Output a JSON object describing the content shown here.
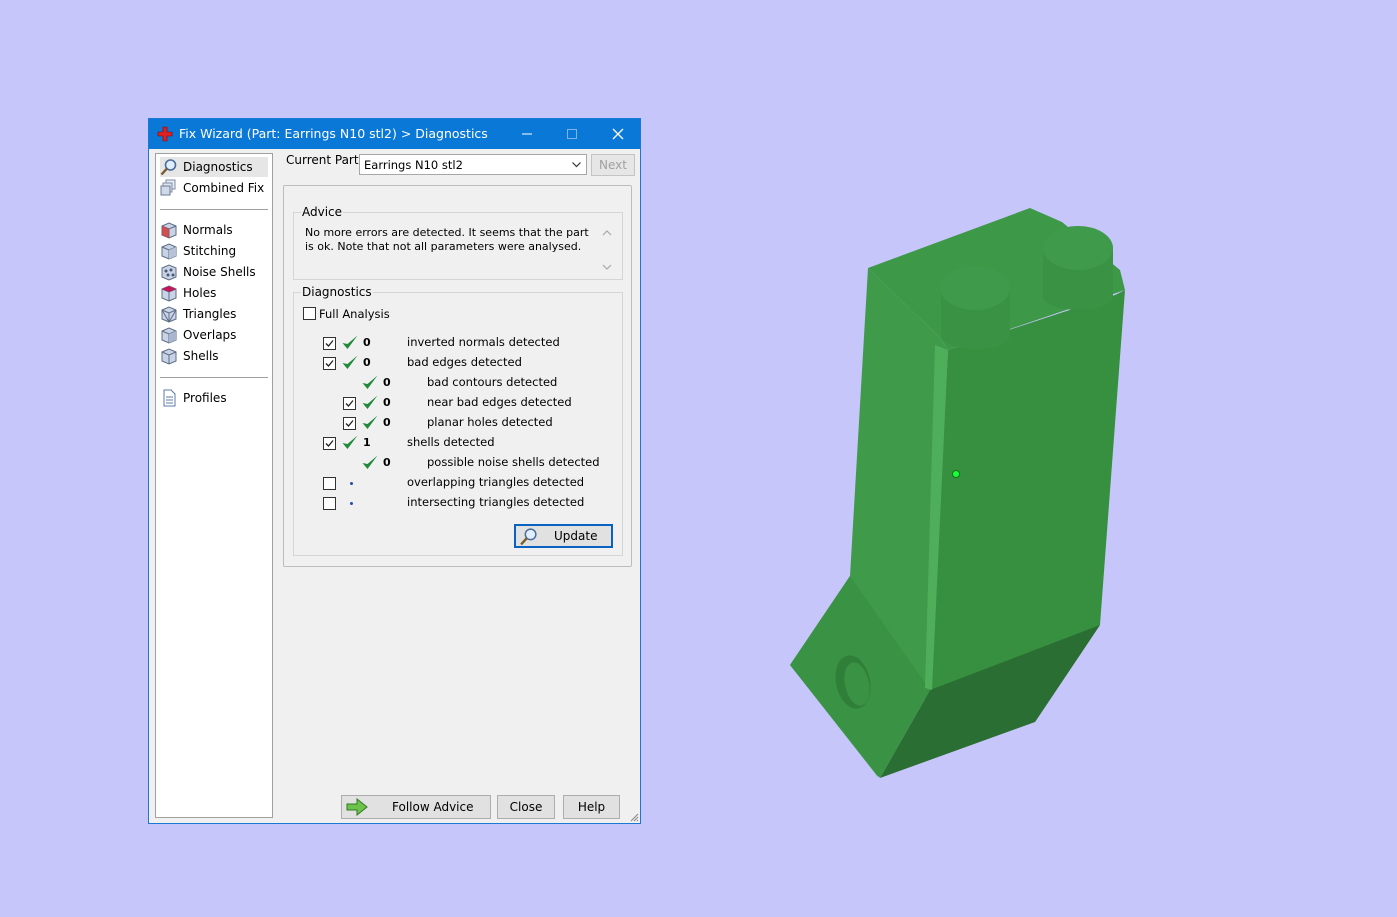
{
  "window": {
    "title": "Fix Wizard (Part: Earrings N10 stl2) > Diagnostics"
  },
  "sidebar": {
    "items": [
      {
        "label": "Diagnostics",
        "icon": "magnifier-icon"
      },
      {
        "label": "Combined Fix",
        "icon": "cube-stack-icon"
      },
      {
        "label": "Normals",
        "icon": "normals-cube-icon"
      },
      {
        "label": "Stitching",
        "icon": "stitching-cube-icon"
      },
      {
        "label": "Noise Shells",
        "icon": "noise-shells-icon"
      },
      {
        "label": "Holes",
        "icon": "holes-cube-icon"
      },
      {
        "label": "Triangles",
        "icon": "triangles-cube-icon"
      },
      {
        "label": "Overlaps",
        "icon": "overlaps-cube-icon"
      },
      {
        "label": "Shells",
        "icon": "shells-cube-icon"
      },
      {
        "label": "Profiles",
        "icon": "document-icon"
      }
    ]
  },
  "header": {
    "current_part_label": "Current Part:",
    "current_part_value": "Earrings N10 stl2",
    "next_label": "Next"
  },
  "advice": {
    "legend": "Advice",
    "text": "No more errors are detected. It seems that the part is ok. Note that not all parameters were analysed."
  },
  "diagnostics": {
    "legend": "Diagnostics",
    "full_analysis_label": "Full Analysis",
    "rows": [
      {
        "checked": true,
        "status": "ok",
        "count": "0",
        "text": "inverted normals detected"
      },
      {
        "checked": true,
        "status": "ok",
        "count": "0",
        "text": "bad edges detected"
      },
      {
        "checked": null,
        "status": "ok",
        "count": "0",
        "text": "bad contours detected"
      },
      {
        "checked": true,
        "status": "ok",
        "count": "0",
        "text": "near bad edges detected"
      },
      {
        "checked": true,
        "status": "ok",
        "count": "0",
        "text": "planar holes detected"
      },
      {
        "checked": true,
        "status": "ok",
        "count": "1",
        "text": "shells detected"
      },
      {
        "checked": null,
        "status": "ok",
        "count": "0",
        "text": "possible noise shells detected"
      },
      {
        "checked": false,
        "status": "none",
        "count": "",
        "text": "overlapping triangles detected"
      },
      {
        "checked": false,
        "status": "none",
        "count": "",
        "text": "intersecting triangles detected"
      }
    ],
    "update_label": "Update"
  },
  "footer": {
    "follow_advice_label": "Follow Advice",
    "close_label": "Close",
    "help_label": "Help"
  },
  "colors": {
    "background": "#c7c6fb",
    "titlebar": "#0a78d7",
    "model_green": "#3a8f45",
    "check_green": "#1e8a3a"
  }
}
